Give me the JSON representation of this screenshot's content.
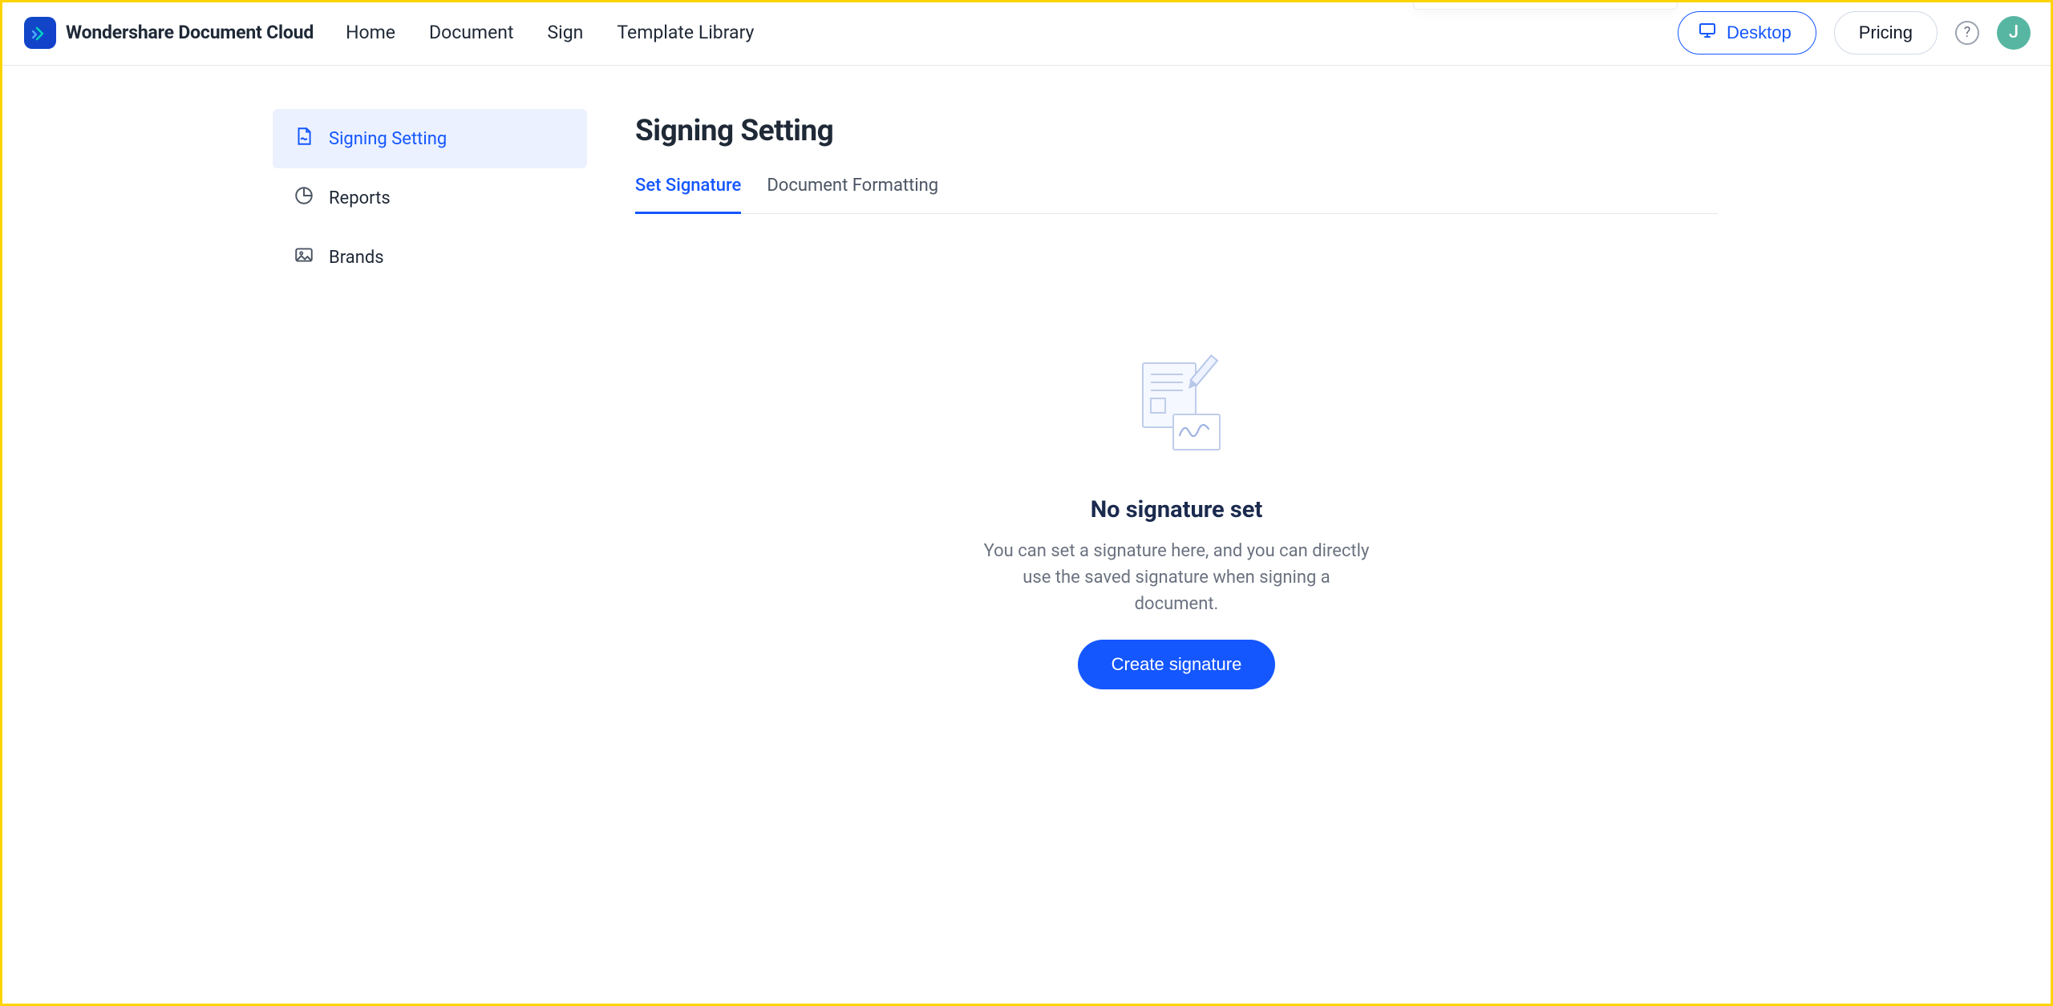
{
  "header": {
    "brand": "Wondershare Document Cloud",
    "nav": {
      "home": "Home",
      "document": "Document",
      "sign": "Sign",
      "template": "Template Library"
    },
    "desktop": "Desktop",
    "pricing": "Pricing",
    "avatar_initial": "J"
  },
  "sidebar": {
    "signing": "Signing Setting",
    "reports": "Reports",
    "brands": "Brands"
  },
  "main": {
    "title": "Signing Setting",
    "tabs": {
      "set": "Set Signature",
      "formatting": "Document Formatting"
    },
    "empty": {
      "title": "No signature set",
      "desc": "You can set a signature here, and you can directly use the saved signature when signing a document.",
      "button": "Create signature"
    }
  }
}
